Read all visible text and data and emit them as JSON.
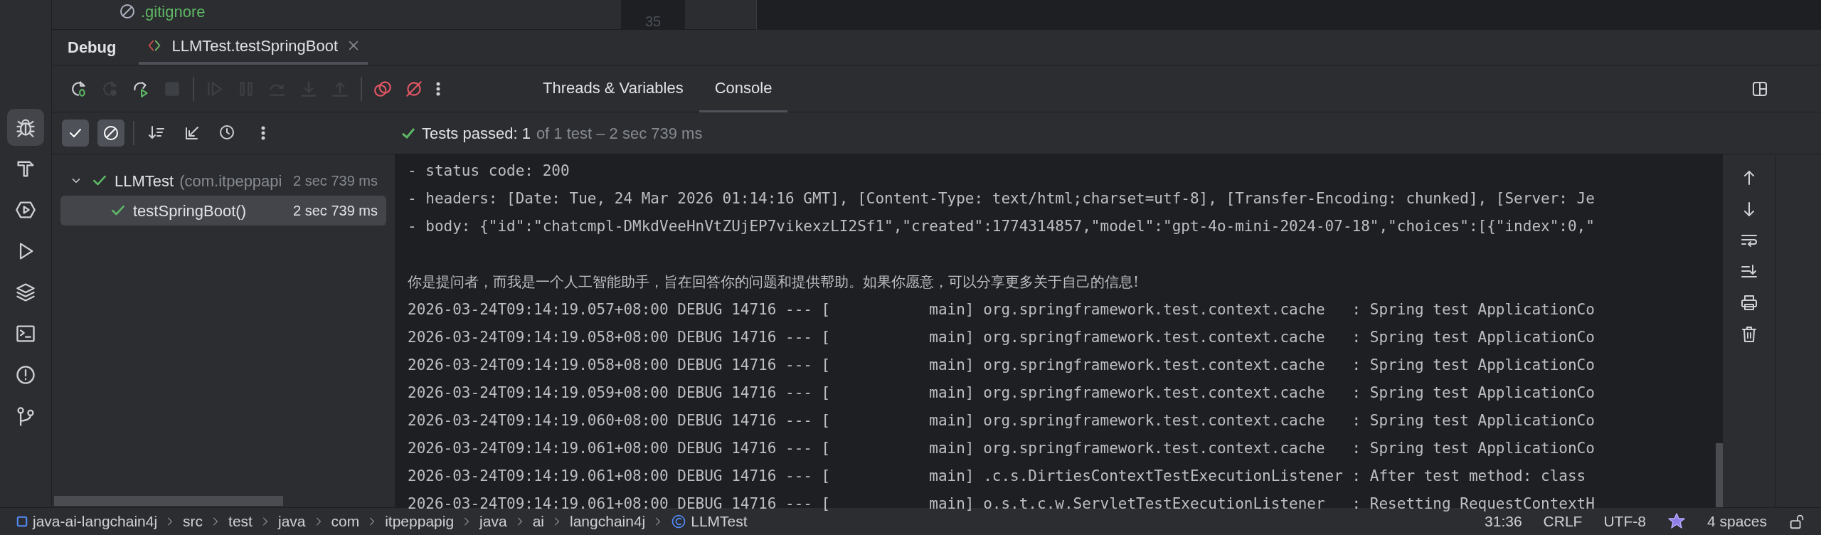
{
  "project_tree": {
    "file": ".gitignore"
  },
  "editor": {
    "line_number": "35"
  },
  "activity_bar": [
    {
      "kind": "debug",
      "selected": true
    },
    {
      "kind": "build",
      "selected": false
    },
    {
      "kind": "services",
      "selected": false
    },
    {
      "kind": "run",
      "selected": false
    },
    {
      "kind": "layers",
      "selected": false
    },
    {
      "kind": "terminal",
      "selected": false
    },
    {
      "kind": "problems",
      "selected": false
    },
    {
      "kind": "git",
      "selected": false
    }
  ],
  "tool_window": {
    "title": "Debug",
    "tabs": [
      {
        "label": "LLMTest.testSpringBoot",
        "selected": true
      }
    ]
  },
  "debug_toolbar": [
    {
      "kind": "rerun",
      "disabled": false
    },
    {
      "kind": "restart",
      "disabled": true
    },
    {
      "kind": "rerun_failed",
      "disabled": false
    },
    {
      "kind": "stop",
      "disabled": true
    },
    {
      "kind": "separator"
    },
    {
      "kind": "resume",
      "disabled": true
    },
    {
      "kind": "pause",
      "disabled": true
    },
    {
      "kind": "step_over",
      "disabled": true
    },
    {
      "kind": "step_into",
      "disabled": true
    },
    {
      "kind": "step_out",
      "disabled": true
    },
    {
      "kind": "separator"
    },
    {
      "kind": "breakpoints",
      "disabled": false
    },
    {
      "kind": "mute",
      "disabled": false
    },
    {
      "kind": "more",
      "disabled": false
    }
  ],
  "view_tabs": [
    {
      "label": "Threads & Variables",
      "selected": false
    },
    {
      "label": "Console",
      "selected": true
    }
  ],
  "test_toolbar": [
    {
      "kind": "passed",
      "on": true
    },
    {
      "kind": "ignored",
      "on": true
    },
    {
      "kind": "separator"
    },
    {
      "kind": "sort",
      "on": false
    },
    {
      "kind": "collapse",
      "on": false
    },
    {
      "kind": "history",
      "on": false
    },
    {
      "kind": "more",
      "on": false
    }
  ],
  "status": {
    "label": "Tests passed: 1",
    "detail": "of 1 test – 2 sec 739 ms"
  },
  "test_tree": [
    {
      "name": "LLMTest",
      "package": "(com.itpeppapi",
      "time": "2 sec 739 ms",
      "expanded": true,
      "selected": false,
      "children": [
        {
          "name": "testSpringBoot()",
          "time": "2 sec 739 ms",
          "selected": true
        }
      ]
    }
  ],
  "console": {
    "lines": [
      {
        "kind": "text",
        "text": "- status code: 200"
      },
      {
        "kind": "text",
        "text": "- headers: [Date: Tue, 24 Mar 2026 01:14:16 GMT], [Content-Type: text/html;charset=utf-8], [Transfer-Encoding: chunked], [Server: Je"
      },
      {
        "kind": "text",
        "text": "- body: {\"id\":\"chatcmpl-DMkdVeeHnVtZUjEP7vikexzLI2Sf1\",\"created\":1774314857,\"model\":\"gpt-4o-mini-2024-07-18\",\"choices\":[{\"index\":0,\""
      },
      {
        "kind": "blank"
      },
      {
        "kind": "cjk",
        "text": "你是提问者，而我是一个人工智能助手，旨在回答你的问题和提供帮助。如果你愿意，可以分享更多关于自己的信息!"
      },
      {
        "kind": "text",
        "text": "2026-03-24T09:14:19.057+08:00 DEBUG 14716 --- [           main] org.springframework.test.context.cache   : Spring test ApplicationCo"
      },
      {
        "kind": "text",
        "text": "2026-03-24T09:14:19.058+08:00 DEBUG 14716 --- [           main] org.springframework.test.context.cache   : Spring test ApplicationCo"
      },
      {
        "kind": "text",
        "text": "2026-03-24T09:14:19.058+08:00 DEBUG 14716 --- [           main] org.springframework.test.context.cache   : Spring test ApplicationCo"
      },
      {
        "kind": "text",
        "text": "2026-03-24T09:14:19.059+08:00 DEBUG 14716 --- [           main] org.springframework.test.context.cache   : Spring test ApplicationCo"
      },
      {
        "kind": "text",
        "text": "2026-03-24T09:14:19.060+08:00 DEBUG 14716 --- [           main] org.springframework.test.context.cache   : Spring test ApplicationCo"
      },
      {
        "kind": "text",
        "text": "2026-03-24T09:14:19.061+08:00 DEBUG 14716 --- [           main] org.springframework.test.context.cache   : Spring test ApplicationCo"
      },
      {
        "kind": "text",
        "text": "2026-03-24T09:14:19.061+08:00 DEBUG 14716 --- [           main] .c.s.DirtiesContextTestExecutionListener : After test method: class"
      },
      {
        "kind": "text",
        "text": "2026-03-24T09:14:19.061+08:00 DEBUG 14716 --- [           main] o.s.t.c.w.ServletTestExecutionListener   : Resetting RequestContextH"
      }
    ]
  },
  "console_toolbar": [
    {
      "kind": "up"
    },
    {
      "kind": "down"
    },
    {
      "kind": "wrap"
    },
    {
      "kind": "scroll_end"
    },
    {
      "kind": "print"
    },
    {
      "kind": "clear"
    }
  ],
  "breadcrumbs": [
    {
      "kind": "module",
      "label": "java-ai-langchain4j"
    },
    {
      "kind": "folder",
      "label": "src"
    },
    {
      "kind": "folder",
      "label": "test"
    },
    {
      "kind": "folder",
      "label": "java"
    },
    {
      "kind": "folder",
      "label": "com"
    },
    {
      "kind": "folder",
      "label": "itpeppapig"
    },
    {
      "kind": "folder",
      "label": "java"
    },
    {
      "kind": "folder",
      "label": "ai"
    },
    {
      "kind": "folder",
      "label": "langchain4j"
    },
    {
      "kind": "class",
      "label": "LLMTest"
    }
  ],
  "status_bar": {
    "position": "31:36",
    "line_separator": "CRLF",
    "encoding": "UTF-8",
    "indent": "4 spaces"
  }
}
